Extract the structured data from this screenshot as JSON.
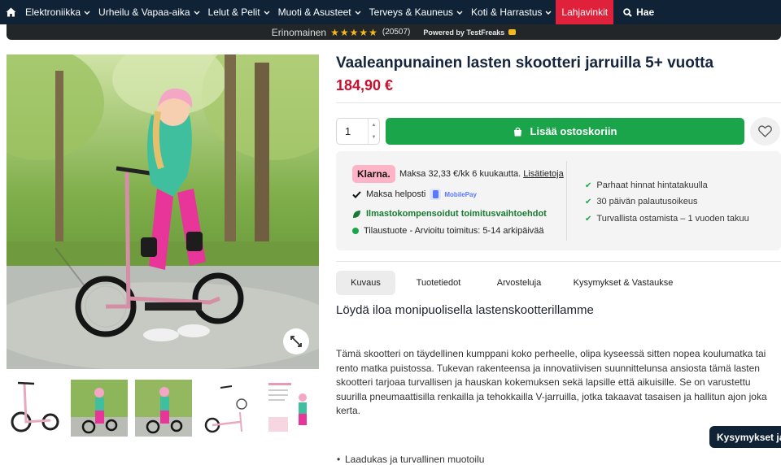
{
  "nav": {
    "home_icon": "home-icon",
    "items": [
      {
        "label": "Elektroniikka"
      },
      {
        "label": "Urheilu & Vapaa-aika"
      },
      {
        "label": "Lelut & Pelit"
      },
      {
        "label": "Muoti & Asusteet"
      },
      {
        "label": "Terveys & Kauneus"
      },
      {
        "label": "Koti & Harrastus"
      }
    ],
    "gift_label": "Lahjavinkit",
    "search_label": "Hae",
    "bg_color": "#0f2236",
    "gift_color": "#e0213b"
  },
  "rating": {
    "label": "Erinomainen",
    "stars": "★★★★★",
    "score_out_of_5": 4.5,
    "count": "(20507)",
    "powered": "Powered by TestFreaks"
  },
  "product": {
    "title": "Vaaleanpunainen lasten skootteri jarruilla 5+ vuotta",
    "price": "184,90 €",
    "quantity": "1",
    "add_to_cart": "Lisää ostoskoriin",
    "cart_color": "#1aa54b",
    "price_color": "#c8102e"
  },
  "payment": {
    "klarna_badge": "Klarna.",
    "klarna_text": "Maksa 32,33 €/kk 6 kuukautta.",
    "klarna_link": "Lisätietoja",
    "pay_easy": "Maksa helposti",
    "mobilepay": "MobilePay",
    "climate": "Ilmastokompensoidut toimitusvaihtoehdot",
    "stock": "Tilaustuote - Arvioitu toimitus: 5-14 arkipäivää"
  },
  "usps": [
    {
      "text": "Parhaat hinnat hintatakuulla"
    },
    {
      "text": "30 päivän palautusoikeus"
    },
    {
      "text": "Turvallista ostamista – 1 vuoden takuu"
    }
  ],
  "tabs": [
    {
      "label": "Kuvaus"
    },
    {
      "label": "Tuotetiedot"
    },
    {
      "label": "Arvosteluja"
    },
    {
      "label": "Kysymykset & Vastaukse"
    }
  ],
  "description": {
    "heading": "Löydä iloa monipuolisella lastenskootterillamme",
    "body": "Tämä skootteri on täydellinen kumppani koko perheelle, olipa kyseessä sitten nopea koulumatka tai rento matka puistossa. Tukevan rakenteensa ja innovatiivisen suunnittelunsa ansiosta tämä lasten skootteri tarjoaa turvallisen ja hauskan kokemuksen sekä lapsille että aikuisille. Se on varustettu suurilla pneumaattisilla renkailla ja tehokkailla V-jarruilla, jotka takaavat tasaisen ja hallitun ajon joka kerta.",
    "bullet": "Laadukas ja turvallinen muotoilu"
  },
  "help_button": "Kysymykset ja v"
}
